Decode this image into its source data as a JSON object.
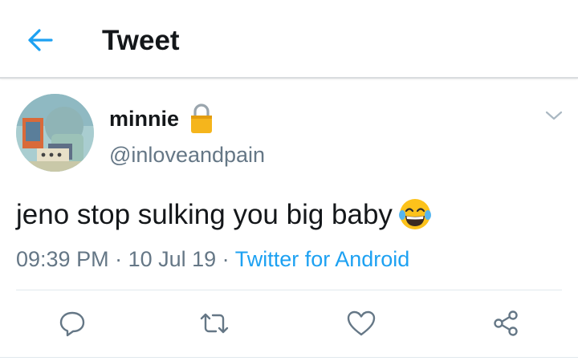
{
  "header": {
    "back_icon": "arrow-left-icon",
    "title": "Tweet"
  },
  "tweet": {
    "avatar_icon": "avatar-image",
    "display_name": "minnie",
    "lock_icon": "lock-icon",
    "handle": "@inloveandpain",
    "caret_icon": "chevron-down-icon",
    "text": "jeno stop sulking you big baby",
    "emoji_icon": "face-with-tears-of-joy-icon",
    "time": "09:39 PM",
    "separator": " · ",
    "date": "10 Jul 19",
    "source": "Twitter for Android"
  },
  "actions": [
    {
      "icon": "reply-icon"
    },
    {
      "icon": "retweet-icon"
    },
    {
      "icon": "like-icon"
    },
    {
      "icon": "share-icon"
    }
  ],
  "colors": {
    "accent": "#1da1f2",
    "text": "#14171a",
    "secondary": "#657786",
    "lock": "#f5b51c"
  }
}
